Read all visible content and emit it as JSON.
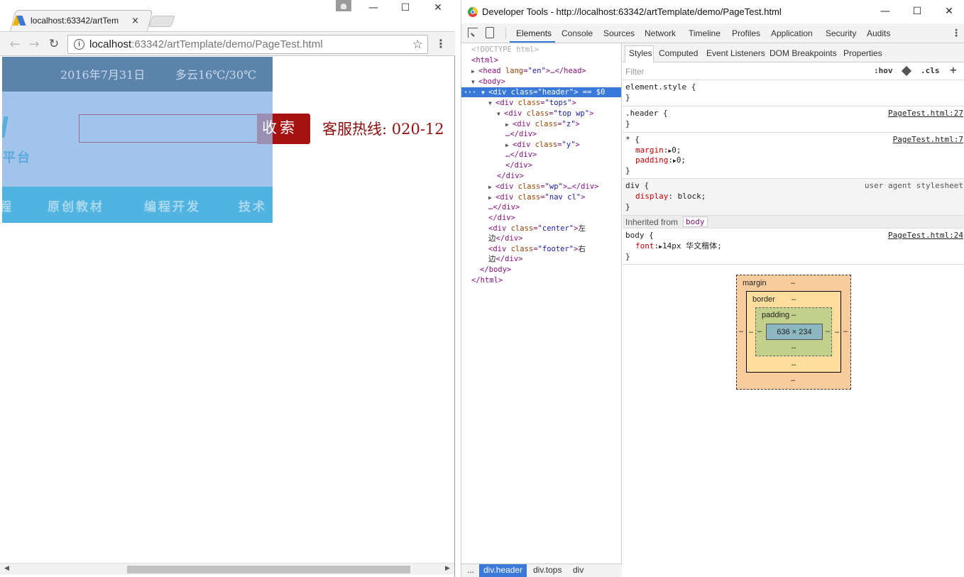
{
  "browser": {
    "tab_title": "localhost:63342/artTem",
    "tab_close": "×",
    "window_controls": {
      "minimize": "—",
      "maximize": "☐",
      "close": "✕"
    },
    "nav": {
      "back": "←",
      "forward": "→",
      "reload": "↻"
    },
    "url_host": "localhost",
    "url_rest": ":63342/artTemplate/demo/PageTest.html",
    "star": "☆",
    "menu": "⋮",
    "icons": [
      "back-arrow-icon",
      "forward-arrow-icon",
      "reload-icon",
      "info-icon",
      "star-icon",
      "menu-dots-icon"
    ]
  },
  "page": {
    "date": "2016年7月31日",
    "weather": "多云16℃/30℃",
    "logo_text": "平台",
    "search_button": "收索",
    "hotline": "客服热线: 020-12",
    "nav_items": [
      "程",
      "原创教材",
      "编程开发",
      "技术"
    ],
    "colors": {
      "tops": "#5c84aa",
      "header": "#a2c4ea",
      "nav": "#51b4e0",
      "search_button": "#a51210",
      "hotline": "#8e0e0e"
    }
  },
  "devtools": {
    "title": "Developer Tools - http://localhost:63342/artTemplate/demo/PageTest.html",
    "window_controls": {
      "minimize": "—",
      "maximize": "☐",
      "close": "✕"
    },
    "tabs": [
      "Elements",
      "Console",
      "Sources",
      "Network",
      "Timeline",
      "Profiles",
      "Application",
      "Security",
      "Audits"
    ],
    "active_tab": "Elements",
    "more": "⋮",
    "dom": {
      "doctype": "<!DOCTYPE html>",
      "html_open": "<html>",
      "head": {
        "tag": "<head ",
        "attr": "lang",
        "val": "\"en\"",
        "tail": ">…</head>"
      },
      "body_open": "<body>",
      "header": {
        "tag": "<div ",
        "attr": "class",
        "val": "\"header\"",
        "tail": "> == $0"
      },
      "tops": {
        "tag": "<div ",
        "attr": "class",
        "val": "\"tops\"",
        "tail": ">"
      },
      "topwp": {
        "tag": "<div ",
        "attr": "class",
        "val": "\"top wp\"",
        "tail": ">"
      },
      "z": {
        "tag": "<div ",
        "attr": "class",
        "val": "\"z\"",
        "tail": ">"
      },
      "z_close": "…</div>",
      "y": {
        "tag": "<div ",
        "attr": "class",
        "val": "\"y\"",
        "tail": ">"
      },
      "y_close": "…</div>",
      "div_close": "</div>",
      "wp": {
        "tag": "<div ",
        "attr": "class",
        "val": "\"wp\"",
        "tail": ">…</div>"
      },
      "navcl": {
        "tag": "<div ",
        "attr": "class",
        "val": "\"nav cl\"",
        "tail": ">"
      },
      "navcl_close": "…</div>",
      "center": {
        "tag": "<div ",
        "attr": "class",
        "val": "\"center\"",
        "tail": ">",
        "text1": "左",
        "text2": "边",
        "close": "</div>"
      },
      "footer": {
        "tag": "<div ",
        "attr": "class",
        "val": "\"footer\"",
        "tail": ">",
        "text1": "右",
        "text2": "边",
        "close": "</div>"
      },
      "body_close": "</body>",
      "html_close": "</html>"
    },
    "breadcrumbs": [
      "...",
      "div.header",
      "div.tops",
      "div"
    ],
    "styles_tabs": [
      "Styles",
      "Computed",
      "Event Listeners",
      "DOM Breakpoints",
      "Properties"
    ],
    "filter_placeholder": "Filter",
    "hov": ":hov",
    "cls": ".cls",
    "plus": "+",
    "rules": {
      "element_style": {
        "selector": "element.style {",
        "close": "}"
      },
      "header": {
        "selector": ".header {",
        "close": "}",
        "source": "PageTest.html:27"
      },
      "star": {
        "selector": "* {",
        "source": "PageTest.html:7",
        "prop1": "margin",
        "val1": "0;",
        "prop2": "padding",
        "val2": "0;",
        "close": "}"
      },
      "div": {
        "selector": "div {",
        "source": "user agent stylesheet",
        "prop": "display",
        "val": "block;",
        "close": "}"
      },
      "inherited_label": "Inherited from",
      "inherited_chip": "body",
      "body": {
        "selector": "body {",
        "source": "PageTest.html:24",
        "prop": "font",
        "val": "14px 华文楷体;",
        "close": "}"
      }
    },
    "box_model": {
      "margin_label": "margin",
      "border_label": "border",
      "padding_label": "padding",
      "dash": "–",
      "content": "636 × 234"
    }
  }
}
